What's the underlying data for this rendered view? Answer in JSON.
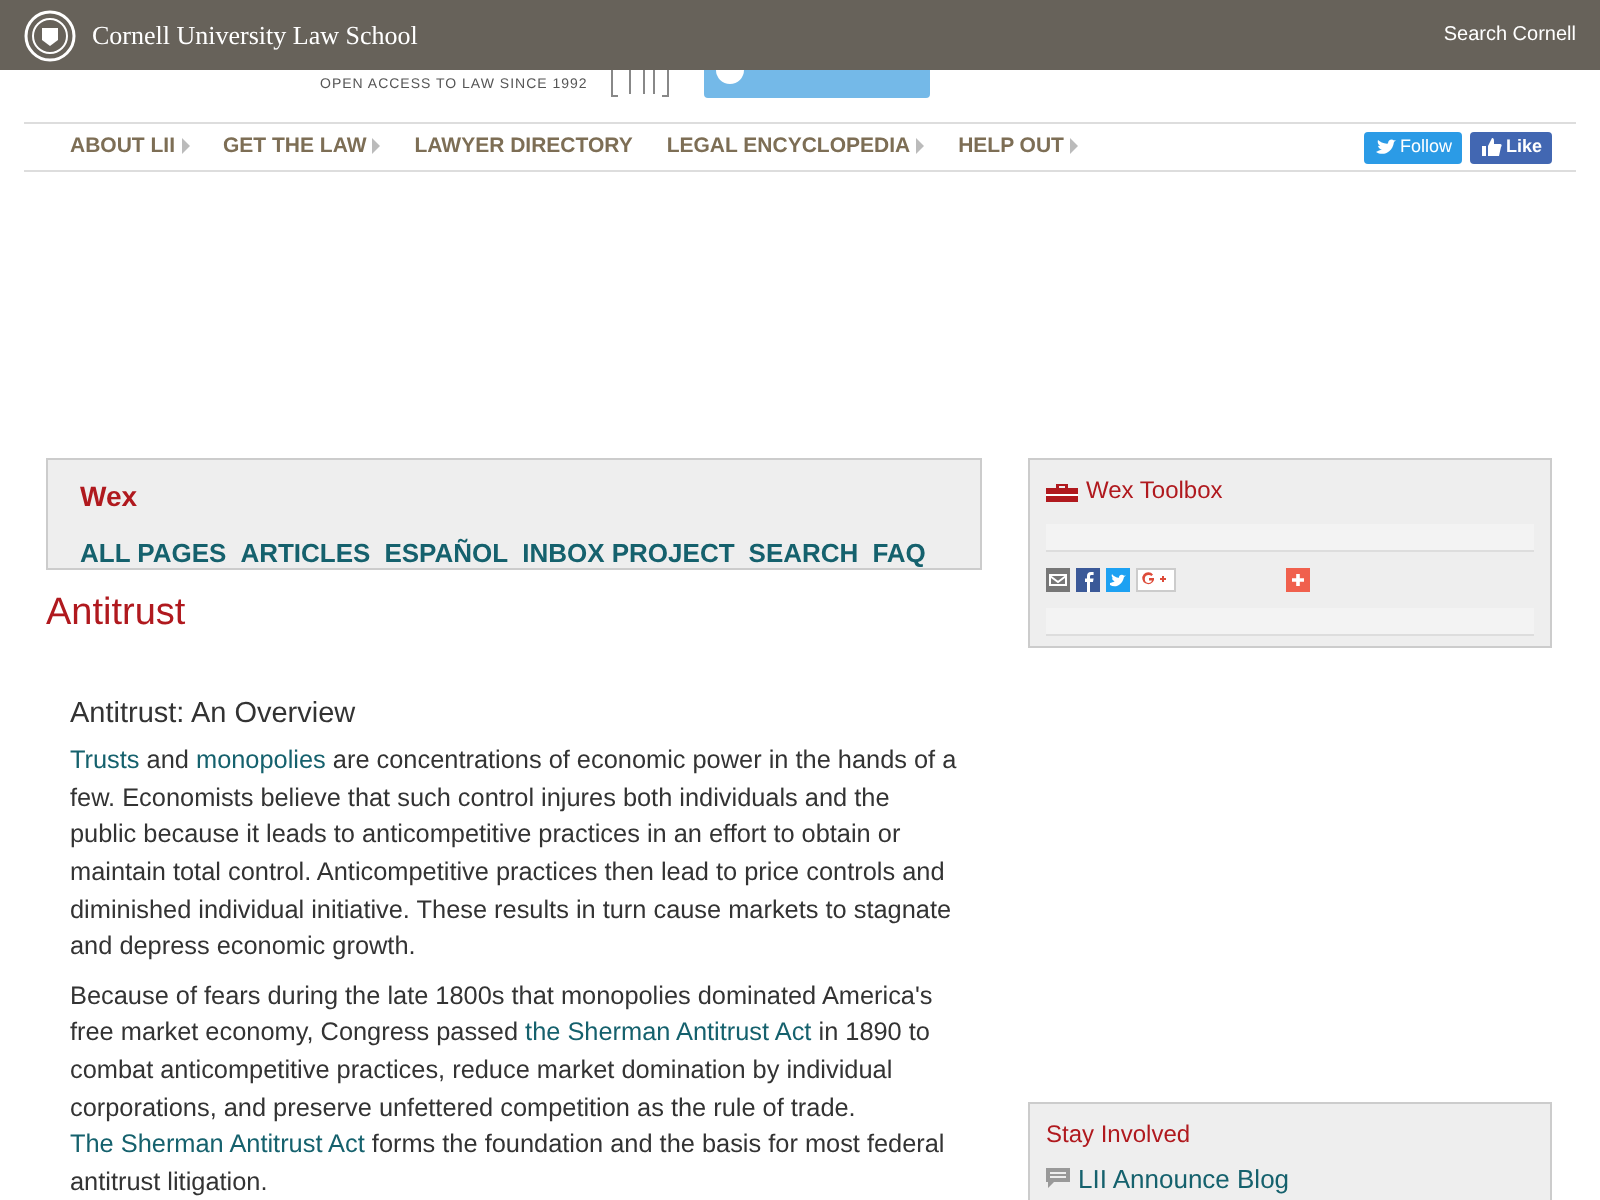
{
  "top_bar": {
    "school": "Cornell University Law School",
    "search_link": "Search Cornell"
  },
  "masthead": {
    "tagline": "OPEN ACCESS TO LAW SINCE 1992"
  },
  "nav": [
    {
      "label": "ABOUT LII",
      "has_submenu": true
    },
    {
      "label": "GET THE LAW",
      "has_submenu": true
    },
    {
      "label": "LAWYER DIRECTORY",
      "has_submenu": false
    },
    {
      "label": "LEGAL ENCYCLOPEDIA",
      "has_submenu": true
    },
    {
      "label": "HELP OUT",
      "has_submenu": true
    }
  ],
  "social": [
    {
      "kind": "twitter",
      "label": "Follow"
    },
    {
      "kind": "facebook",
      "label": "Like"
    }
  ],
  "wex": {
    "title": "Wex",
    "links": [
      "ALL PAGES",
      "ARTICLES",
      "ESPAÑOL",
      "INBOX PROJECT",
      "SEARCH",
      "FAQ"
    ]
  },
  "page_title": "Antitrust",
  "article": {
    "heading": "Antitrust: An Overview",
    "paragraphs": [
      [
        {
          "text": "Trusts",
          "link": true
        },
        {
          "text": " and ",
          "link": false
        },
        {
          "text": "monopolies",
          "link": true
        },
        {
          "text": " are concentrations of economic power in the hands of a few. Economists believe that such control injures both individuals and the public because it leads to anticompetitive practices in an effort to obtain or maintain total control. Anticompetitive practices then lead to price controls and diminished individual initiative. These results in turn cause markets to stagnate and depress economic growth.",
          "link": false
        }
      ],
      [
        {
          "text": "Because of fears during the late 1800s that monopolies dominated America's free market economy, Congress passed ",
          "link": false
        },
        {
          "text": "the Sherman Antitrust Act",
          "link": true
        },
        {
          "text": " in 1890 to combat anticompetitive practices, reduce market domination by individual corporations, and preserve unfettered competition as the rule of trade. ",
          "link": false
        },
        {
          "text": "The Sherman Antitrust Act",
          "link": true
        },
        {
          "text": " forms the foundation and the basis for most federal antitrust litigation.",
          "link": false
        }
      ]
    ]
  },
  "toolbox": {
    "title": "Wex Toolbox",
    "share": [
      {
        "kind": "email"
      },
      {
        "kind": "facebook"
      },
      {
        "kind": "twitter"
      },
      {
        "kind": "google"
      },
      {
        "kind": "more"
      }
    ]
  },
  "stay_involved": {
    "title": "Stay Involved",
    "items": [
      "LII Announce Blog"
    ]
  }
}
